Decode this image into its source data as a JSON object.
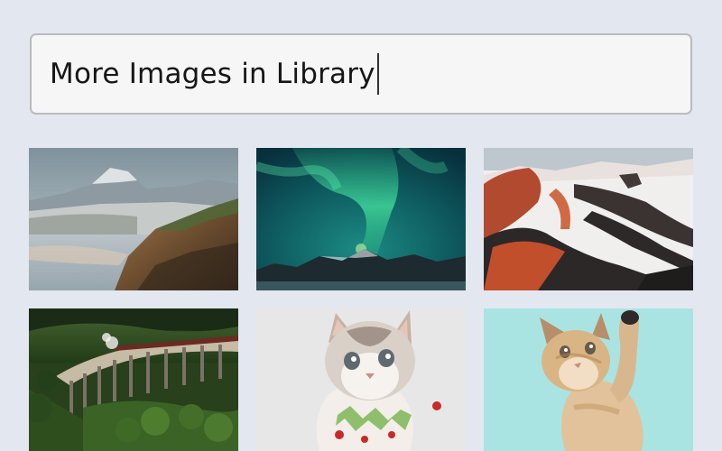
{
  "search": {
    "value": "More Images in Library"
  },
  "gallery": {
    "images": [
      {
        "subject": "coastal cliffs and mountains"
      },
      {
        "subject": "northern lights over mountains"
      },
      {
        "subject": "snowy volcanic mountains"
      },
      {
        "subject": "stone railway viaduct with steam train"
      },
      {
        "subject": "fluffy kitten with green collar"
      },
      {
        "subject": "kitten reaching up on teal background"
      }
    ]
  },
  "colors": {
    "background": "#e3e7ef",
    "search_border": "#b9bbbf",
    "search_fill": "#f6f6f7"
  }
}
